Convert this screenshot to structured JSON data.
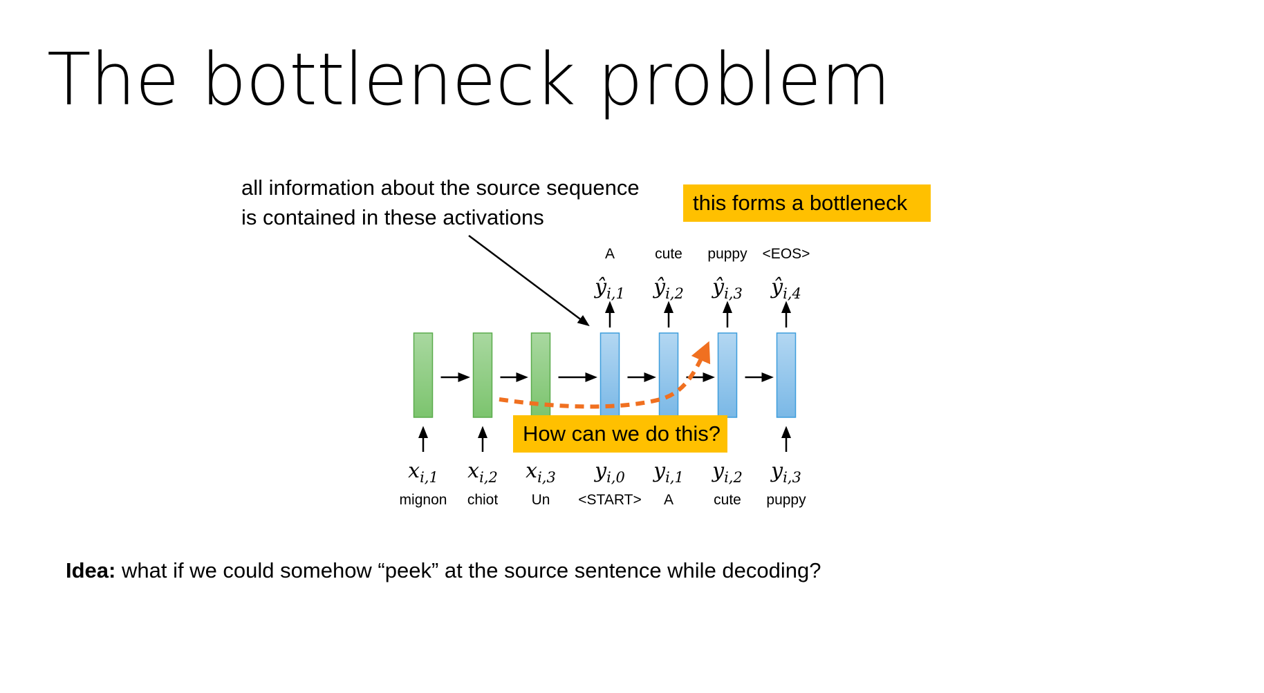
{
  "slide": {
    "title": "The bottleneck problem",
    "annotation_lines": [
      "all information about the source sequence",
      "is contained in these activations"
    ],
    "bottleneck_label": "this forms a bottleneck",
    "question_label": "How can we do this?",
    "idea_prefix": "Idea:",
    "idea_text": " what if we could somehow “peek” at the source sentence while decoding?"
  },
  "diagram": {
    "encoder": [
      {
        "input_var": "x",
        "input_sub": "i,1",
        "word": "mignon"
      },
      {
        "input_var": "x",
        "input_sub": "i,2",
        "word": "chiot"
      },
      {
        "input_var": "x",
        "input_sub": "i,3",
        "word": "Un"
      }
    ],
    "decoder": [
      {
        "input_var": "y",
        "input_sub": "i,0",
        "word": "<START>",
        "output_var": "ŷ",
        "output_sub": "i,1",
        "output_word": "A"
      },
      {
        "input_var": "y",
        "input_sub": "i,1",
        "word": "A",
        "output_var": "ŷ",
        "output_sub": "i,2",
        "output_word": "cute"
      },
      {
        "input_var": "y",
        "input_sub": "i,2",
        "word": "cute",
        "output_var": "ŷ",
        "output_sub": "i,3",
        "output_word": "puppy"
      },
      {
        "input_var": "y",
        "input_sub": "i,3",
        "word": "puppy",
        "output_var": "ŷ",
        "output_sub": "i,4",
        "output_word": "<EOS>"
      }
    ],
    "colors": {
      "encoder_fill_top": "#a9d8a0",
      "encoder_fill_bottom": "#7cc46e",
      "encoder_stroke": "#5aab4c",
      "decoder_fill_top": "#b3d7f2",
      "decoder_fill_bottom": "#7ab8e6",
      "decoder_stroke": "#3d9ddc",
      "attention_arrow": "#f07020",
      "highlight": "#ffc000"
    }
  }
}
